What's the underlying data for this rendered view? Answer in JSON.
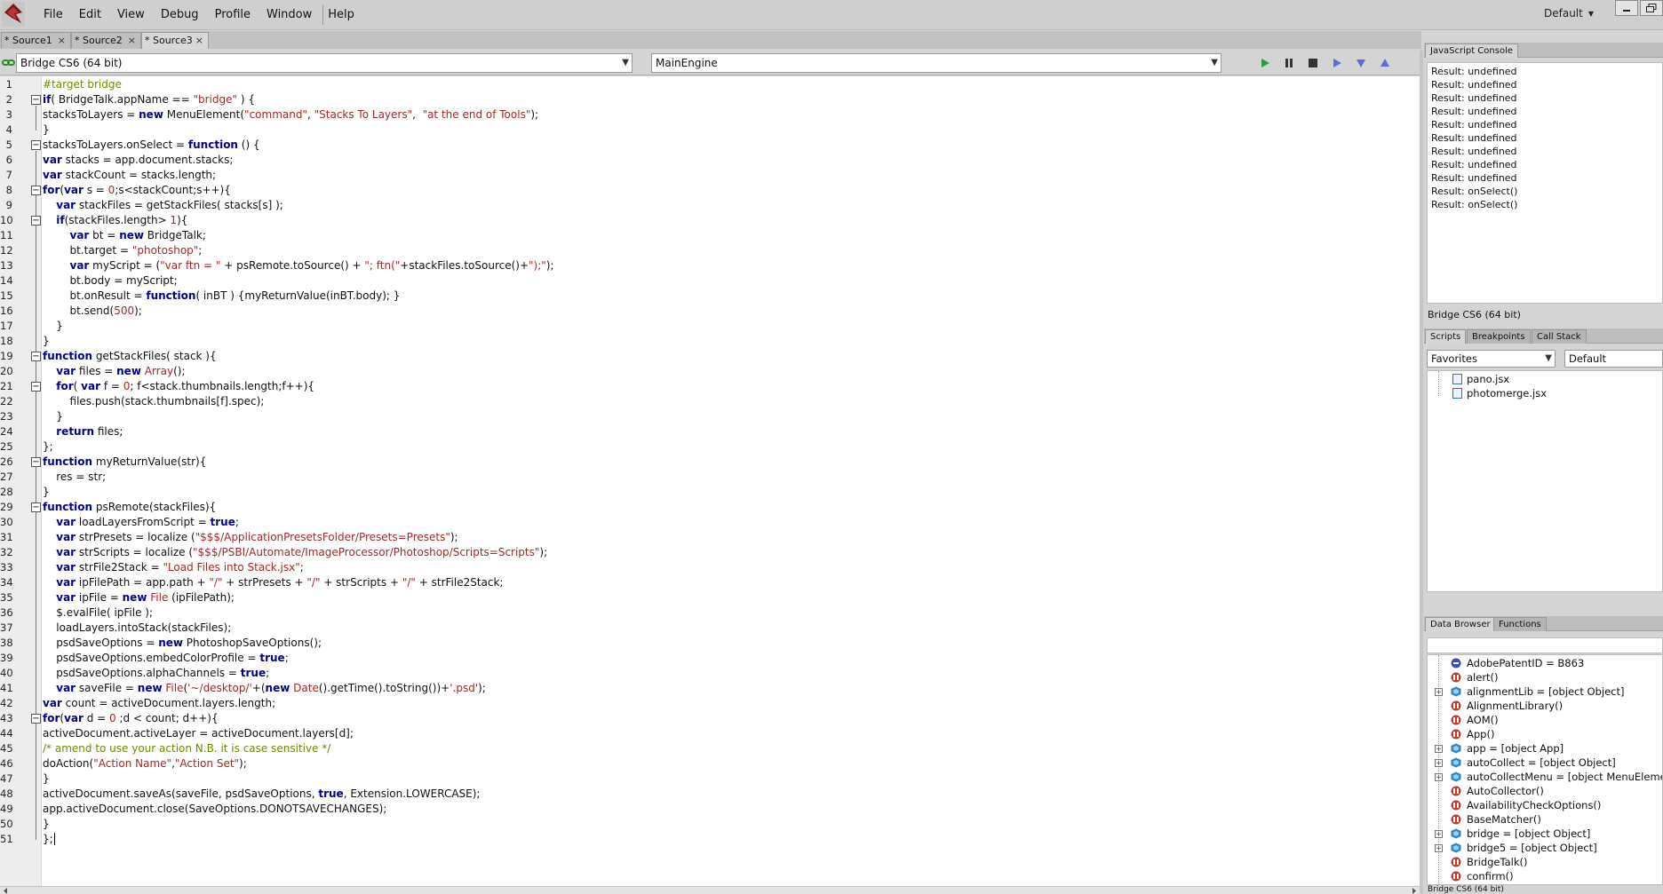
{
  "menubar": {
    "items": [
      "File",
      "Edit",
      "View",
      "Debug",
      "Profile",
      "Window",
      "Help"
    ],
    "workspace": "Default"
  },
  "tabs": [
    "* Source1",
    "* Source2",
    "* Source3"
  ],
  "target": {
    "application": "Bridge CS6 (64 bit)",
    "engine": "MainEngine"
  },
  "editor": {
    "line_numbers": [
      "1",
      "2",
      "3",
      "4",
      "5",
      "6",
      "7",
      "8",
      "9",
      "10",
      "11",
      "12",
      "13",
      "14",
      "15",
      "16",
      "17",
      "18",
      "19",
      "20",
      "21",
      "22",
      "23",
      "24",
      "25",
      "26",
      "27",
      "28",
      "29",
      "30",
      "31",
      "32",
      "33",
      "34",
      "35",
      "36",
      "37",
      "38",
      "39",
      "40",
      "41",
      "42",
      "43",
      "44",
      "45",
      "46",
      "47",
      "48",
      "49",
      "50",
      "51"
    ],
    "lines": [
      "#target bridge",
      "if( BridgeTalk.appName == \"bridge\" ) {",
      "stacksToLayers = new MenuElement(\"command\", \"Stacks To Layers\",  \"at the end of Tools\");",
      "}",
      "stacksToLayers.onSelect = function () {",
      "var stacks = app.document.stacks;",
      "var stackCount = stacks.length;",
      "for(var s = 0;s<stackCount;s++){",
      "    var stackFiles = getStackFiles( stacks[s] );",
      "    if(stackFiles.length> 1){",
      "        var bt = new BridgeTalk;",
      "        bt.target = \"photoshop\";",
      "        var myScript = (\"var ftn = \" + psRemote.toSource() + \"; ftn(\"+stackFiles.toSource()+\");\");",
      "        bt.body = myScript;",
      "        bt.onResult = function( inBT ) {myReturnValue(inBT.body); }",
      "        bt.send(500);",
      "    }",
      "}",
      "function getStackFiles( stack ){",
      "    var files = new Array();",
      "    for( var f = 0; f<stack.thumbnails.length;f++){",
      "        files.push(stack.thumbnails[f].spec);",
      "    }",
      "    return files;",
      "};",
      "function myReturnValue(str){",
      "    res = str;",
      "}",
      "function psRemote(stackFiles){",
      "    var loadLayersFromScript = true;",
      "    var strPresets = localize (\"$$$/ApplicationPresetsFolder/Presets=Presets\");",
      "    var strScripts = localize (\"$$$/PSBI/Automate/ImageProcessor/Photoshop/Scripts=Scripts\");",
      "    var strFile2Stack = \"Load Files into Stack.jsx\";",
      "    var ipFilePath = app.path + \"/\" + strPresets + \"/\" + strScripts + \"/\" + strFile2Stack;",
      "    var ipFile = new File (ipFilePath);",
      "    $.evalFile( ipFile );",
      "    loadLayers.intoStack(stackFiles);",
      "    psdSaveOptions = new PhotoshopSaveOptions();",
      "    psdSaveOptions.embedColorProfile = true;",
      "    psdSaveOptions.alphaChannels = true;",
      "    var saveFile = new File('~/desktop/'+(new Date().getTime().toString())+'.psd');",
      "var count = activeDocument.layers.length;",
      "for(var d = 0 ;d < count; d++){",
      "activeDocument.activeLayer = activeDocument.layers[d];",
      "/* amend to use your action N.B. it is case sensitive */",
      "doAction(\"Action Name\",\"Action Set\");",
      "}",
      "activeDocument.saveAs(saveFile, psdSaveOptions, true, Extension.LOWERCASE);",
      "app.activeDocument.close(SaveOptions.DONOTSAVECHANGES);",
      "}",
      "};"
    ]
  },
  "console": {
    "tab": "JavaScript Console",
    "lines": [
      "Result: undefined",
      "Result: undefined",
      "Result: undefined",
      "Result: undefined",
      "Result: undefined",
      "Result: undefined",
      "Result: undefined",
      "Result: undefined",
      "Result: undefined",
      "Result: onSelect()",
      "Result: onSelect()"
    ],
    "status": "Bridge CS6 (64 bit)"
  },
  "scripts_panel": {
    "tabs": [
      "Scripts",
      "Breakpoints",
      "Call Stack"
    ],
    "favorites": "Favorites",
    "default": "Default",
    "items": [
      "pano.jsx",
      "photomerge.jsx"
    ]
  },
  "data_browser": {
    "tabs": [
      "Data Browser",
      "Functions"
    ],
    "items": [
      {
        "label": "AdobePatentID = B863",
        "kind": "value",
        "expandable": false
      },
      {
        "label": "alert()",
        "kind": "function",
        "expandable": false
      },
      {
        "label": "alignmentLib = [object Object]",
        "kind": "object",
        "expandable": true
      },
      {
        "label": "AlignmentLibrary()",
        "kind": "function",
        "expandable": false
      },
      {
        "label": "AOM()",
        "kind": "function",
        "expandable": false
      },
      {
        "label": "App()",
        "kind": "function",
        "expandable": false
      },
      {
        "label": "app = [object App]",
        "kind": "object",
        "expandable": true
      },
      {
        "label": "autoCollect = [object Object]",
        "kind": "object",
        "expandable": true
      },
      {
        "label": "autoCollectMenu = [object MenuElement]",
        "kind": "object",
        "expandable": true
      },
      {
        "label": "AutoCollector()",
        "kind": "function",
        "expandable": false
      },
      {
        "label": "AvailabilityCheckOptions()",
        "kind": "function",
        "expandable": false
      },
      {
        "label": "BaseMatcher()",
        "kind": "function",
        "expandable": false
      },
      {
        "label": "bridge = [object Object]",
        "kind": "object",
        "expandable": true
      },
      {
        "label": "bridge5 = [object Object]",
        "kind": "object",
        "expandable": true
      },
      {
        "label": "BridgeTalk()",
        "kind": "function",
        "expandable": false
      },
      {
        "label": "confirm()",
        "kind": "function",
        "expandable": false
      }
    ],
    "status": "Bridge CS6 (64 bit)"
  }
}
